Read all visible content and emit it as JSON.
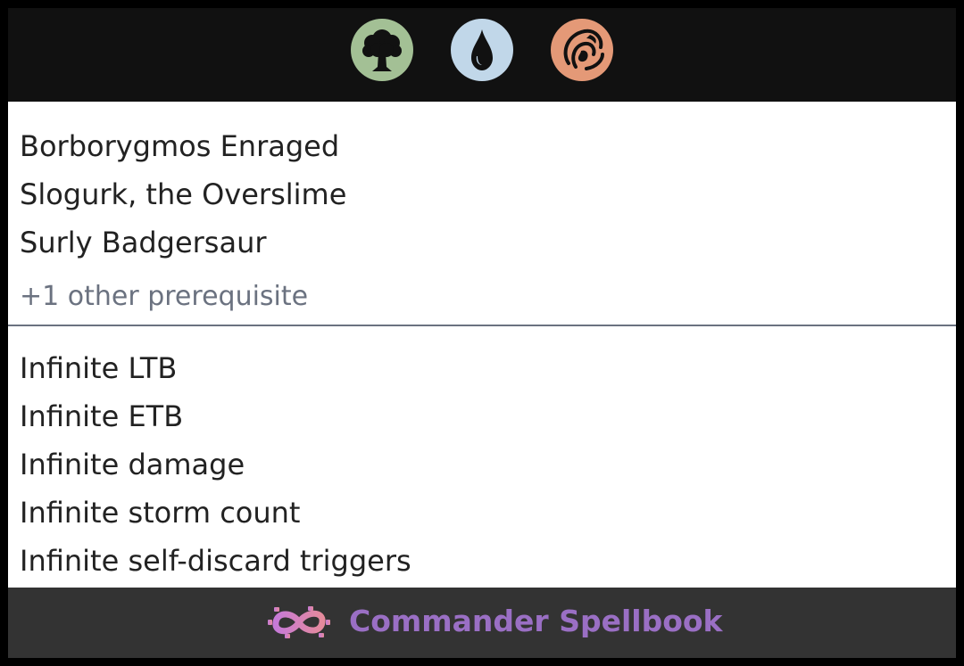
{
  "colors": {
    "background": "#000000",
    "header": "#111111",
    "footer": "#333333",
    "brand": "#9a6fc4",
    "green_mana": "#a3c095",
    "blue_mana": "#c1d7e9",
    "red_mana": "#e49977"
  },
  "header": {
    "mana_icons": [
      "green-mana-icon",
      "blue-mana-icon",
      "red-mana-icon"
    ]
  },
  "prerequisites": {
    "cards": [
      "Borborygmos Enraged",
      "Slogurk, the Overslime",
      "Surly Badgersaur"
    ],
    "other": "+1 other prerequisite"
  },
  "results": [
    "Infinite LTB",
    "Infinite ETB",
    "Infinite damage",
    "Infinite storm count",
    "Infinite self-discard triggers"
  ],
  "footer": {
    "brand": "Commander Spellbook",
    "icon": "infinity-logo-icon"
  }
}
